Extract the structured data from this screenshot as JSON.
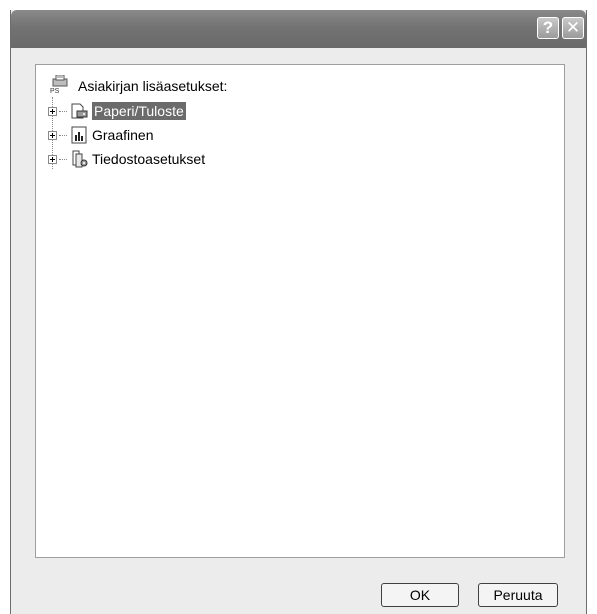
{
  "titlebar": {
    "help_label": "?",
    "close_label": "✕"
  },
  "tree": {
    "root": {
      "label": "Asiakirjan lisäasetukset:",
      "icon": "printer-ps-icon"
    },
    "items": [
      {
        "label": "Paperi/Tuloste",
        "icon": "paper-printer-icon",
        "selected": true
      },
      {
        "label": "Graafinen",
        "icon": "graphics-chart-icon",
        "selected": false
      },
      {
        "label": "Tiedostoasetukset",
        "icon": "document-options-icon",
        "selected": false
      }
    ]
  },
  "buttons": {
    "ok": "OK",
    "cancel": "Peruuta"
  },
  "colors": {
    "titlebar": "#727272",
    "selection": "#6b6b6b",
    "window_bg": "#ececec"
  }
}
